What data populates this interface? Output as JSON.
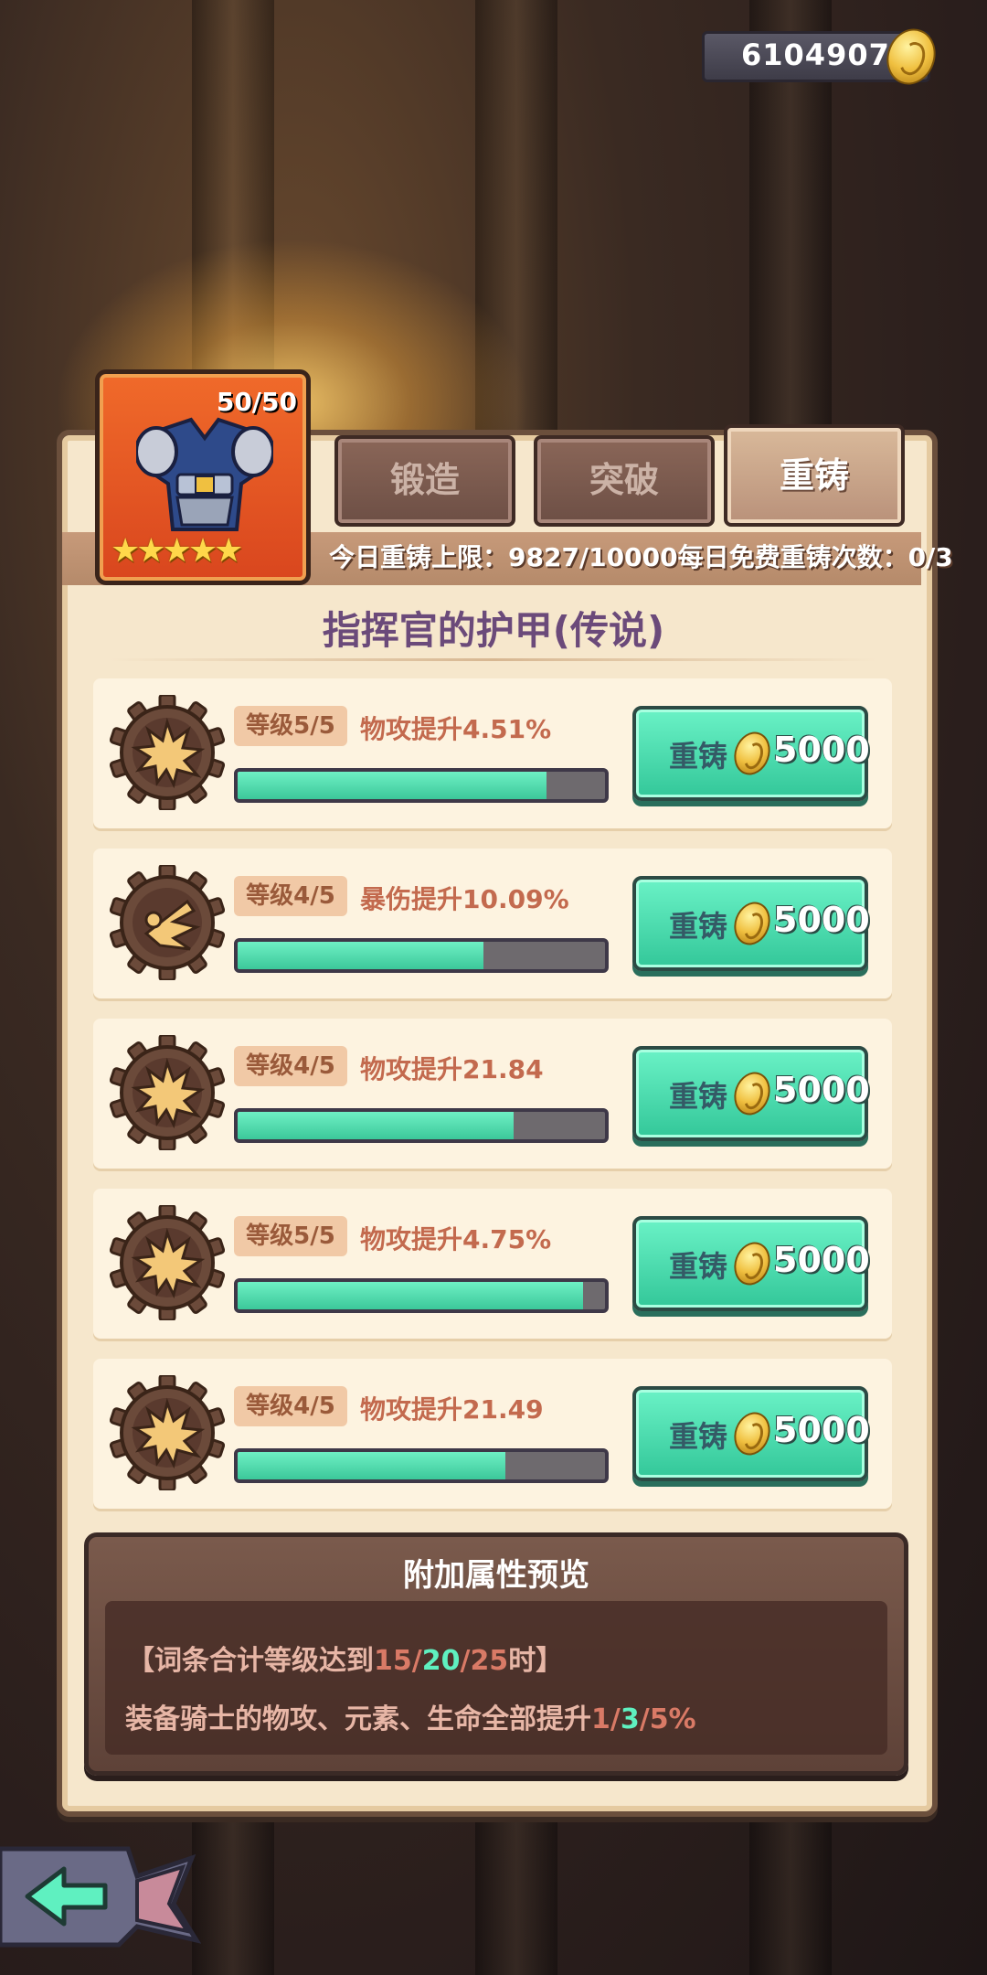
{
  "currency": {
    "amount": "6104907",
    "icon": "gold-coin-icon"
  },
  "equipment": {
    "count": "50/50",
    "stars": "★★★★★",
    "icon": "armor-icon"
  },
  "tabs": [
    {
      "label": "锻造"
    },
    {
      "label": "突破"
    },
    {
      "label": "重铸",
      "active": true
    }
  ],
  "limits": {
    "text": "今日重铸上限：9827/10000每日免费重铸次数：0/3"
  },
  "title": "指挥官的护甲(传说)",
  "rows": [
    {
      "level": "等级5/5",
      "stat": "物攻提升4.51%",
      "progress": 0.84,
      "icon": "explosion-icon",
      "button": "重铸",
      "cost": "5000"
    },
    {
      "level": "等级4/5",
      "stat": "暴伤提升10.09%",
      "progress": 0.67,
      "icon": "crit-burst-icon",
      "button": "重铸",
      "cost": "5000"
    },
    {
      "level": "等级4/5",
      "stat": "物攻提升21.84",
      "progress": 0.75,
      "icon": "explosion-icon",
      "button": "重铸",
      "cost": "5000"
    },
    {
      "level": "等级5/5",
      "stat": "物攻提升4.75%",
      "progress": 0.94,
      "icon": "explosion-icon",
      "button": "重铸",
      "cost": "5000"
    },
    {
      "level": "等级4/5",
      "stat": "物攻提升21.49",
      "progress": 0.73,
      "icon": "explosion-icon",
      "button": "重铸",
      "cost": "5000"
    }
  ],
  "preview": {
    "title": "附加属性预览",
    "line1_pre": "【词条合计等级达到",
    "line1_a": "15",
    "line1_sep1": "/",
    "line1_b": "20",
    "line1_sep2": "/",
    "line1_c": "25",
    "line1_post": "时】",
    "line2_pre": "装备骑士的物攻、元素、生命全部提升",
    "line2_a": "1",
    "line2_sep1": "/",
    "line2_b": "3",
    "line2_sep2": "/",
    "line2_c": "5%"
  },
  "colors": {
    "accent_green": "#3cc89a",
    "panel": "#f6e7cc",
    "title_purple": "#6b4a7a"
  }
}
